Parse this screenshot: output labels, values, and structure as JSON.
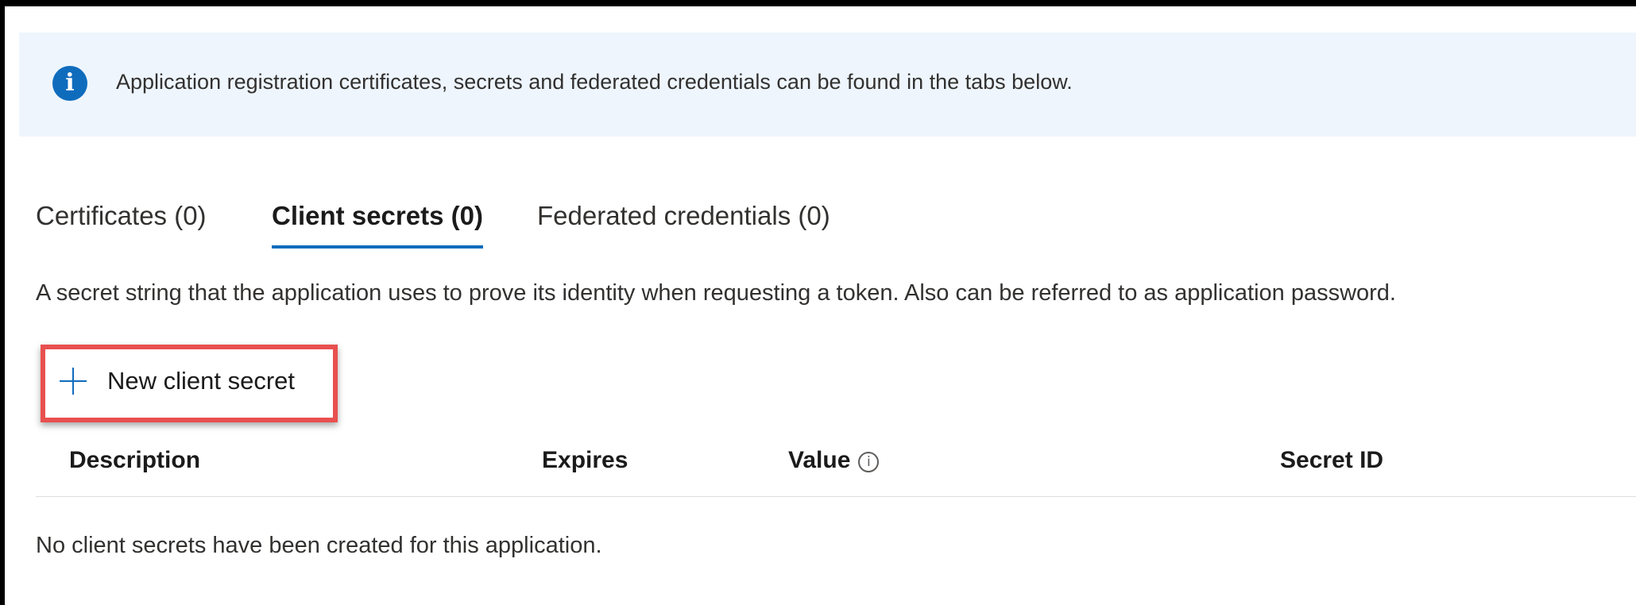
{
  "info_banner": {
    "icon": "info-icon",
    "text": "Application registration certificates, secrets and federated credentials can be found in the tabs below."
  },
  "tabs": [
    {
      "label": "Certificates (0)",
      "active": false
    },
    {
      "label": "Client secrets (0)",
      "active": true
    },
    {
      "label": "Federated credentials (0)",
      "active": false
    }
  ],
  "description": "A secret string that the application uses to prove its identity when requesting a token. Also can be referred to as application password.",
  "toolbar": {
    "new_secret_label": "New client secret",
    "new_secret_icon": "plus-icon",
    "highlight_color": "#e8504f"
  },
  "table": {
    "columns": [
      "Description",
      "Expires",
      "Value",
      "Secret ID"
    ],
    "empty_message": "No client secrets have been created for this application."
  },
  "colors": {
    "accent": "#0f6cbd",
    "banner_bg": "#eef5fd"
  }
}
